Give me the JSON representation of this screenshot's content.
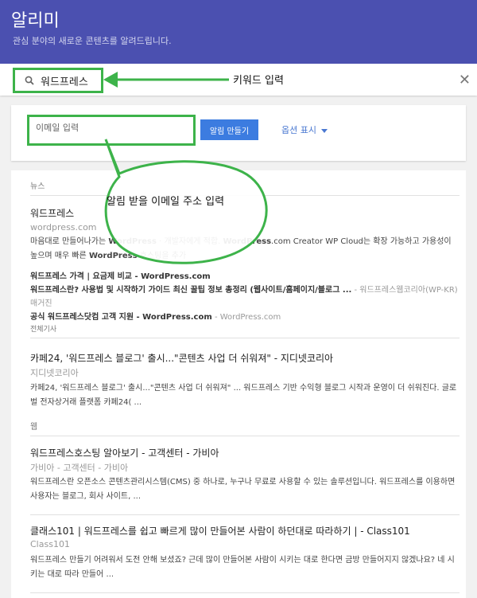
{
  "header": {
    "title": "알리미",
    "subtitle": "관심 분야의 새로운 콘텐츠를 알려드립니다."
  },
  "search": {
    "value": "워드프레스",
    "clear_icon": "close-icon"
  },
  "annotations": {
    "keyword": "키워드 입력",
    "email": "알림 받을 이메일 주소 입력",
    "color": "#3db34a"
  },
  "settings": {
    "email_placeholder": "이메일 입력",
    "create_button": "알림 만들기",
    "options_link": "옵션 표시"
  },
  "preview": {
    "news_label": "뉴스",
    "web_label": "웹",
    "news": [
      {
        "title": "워드프레스",
        "source": "wordpress.com",
        "snippet_parts": [
          "마음대로 만들어나가는 ",
          "WordPress",
          " · 개발자에게 적합. ",
          "WordPress",
          ".com Creator WP Cloud는 확장 가능하고 가용성이 높으며 매우 빠른 ",
          "WordPress",
          " 호스팅을 추가"
        ],
        "links": [
          {
            "text": "워드프레스 가격 | 요금제 비교 - WordPress.com",
            "source": " - WordPress.com"
          },
          {
            "text": "워드프레스란? 사용법 및 시작하기 가이드 최신 꿀팁 정보 총정리 (웹사이트/홈페이지/블로그 ...",
            "source": " - 워드프레스웹코리아(WP-KR) 매거진"
          },
          {
            "text": "공식 워드프레스닷컴 고객 지원 - WordPress.com",
            "source": " - WordPress.com"
          }
        ],
        "tag": "전체기사"
      },
      {
        "title": "카페24, '워드프레스 블로그' 출시...\"콘텐츠 사업 더 쉬워져\" - 지디넷코리아",
        "source": "지디넷코리아",
        "snippet": "카페24, '워드프레스 블로그' 출시...\"콘텐츠 사업 더 쉬워져\" ... 워드프레스 기반 수익형 블로그 시작과 운영이 더 쉬워진다. 글로벌 전자상거래 플랫폼 카페24( ..."
      }
    ],
    "web": [
      {
        "title": "워드프레스호스팅 알아보기 - 고객센터 - 가비아",
        "source": "가비아 - 고객센터 - 가비아",
        "snippet": "워드프레스란 오픈소스 콘텐츠관리시스템(CMS) 중 하나로, 누구나 무료로 사용할 수 있는 솔루션입니다. 워드프레스를 이용하면 사용자는 블로그, 회사 사이트, ..."
      },
      {
        "title": "클래스101 | 워드프레스를 쉽고 빠르게 많이 만들어본 사람이 하던대로 따라하기 | - Class101",
        "source": "Class101",
        "snippet": "워드프레스 만들기 어려워서 도전 안해 보셨죠? 근데 많이 만들어본 사람이 시키는 대로 한다면 금방 만들어지지 않겠나요? 네 시키는 대로 따라 만들어 ..."
      }
    ]
  }
}
